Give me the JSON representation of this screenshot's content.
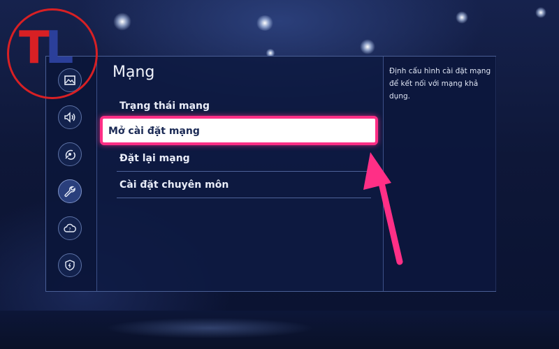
{
  "screen": {
    "title": "Mạng",
    "menu": [
      {
        "label": "Trạng thái mạng"
      },
      {
        "label": "Mở cài đặt mạng",
        "selected": true
      },
      {
        "label": "Đặt lại mạng"
      },
      {
        "label": "Cài đặt chuyên môn"
      }
    ],
    "description": "Định cấu hình cài đặt mạng để kết nối với mạng khả dụng."
  },
  "sidebar": {
    "icons": [
      "picture-icon",
      "sound-icon",
      "broadcast-icon",
      "wrench-icon",
      "cloud-support-icon",
      "shield-icon"
    ],
    "active_index": 3
  },
  "logo": {
    "letters_t": "T",
    "letters_l": "L"
  },
  "colors": {
    "highlight_border": "#ff2f86",
    "arrow": "#ff2f86",
    "logo_red": "#d82024",
    "logo_blue": "#2b3f9a"
  }
}
